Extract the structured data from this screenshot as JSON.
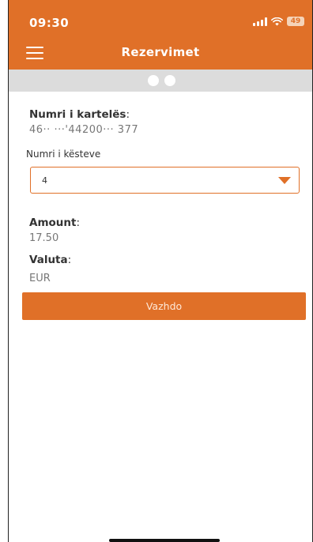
{
  "status_bar": {
    "time": "09:30",
    "battery": "49"
  },
  "nav": {
    "title": "Rezervimet"
  },
  "card": {
    "label": "Numri i kartelës",
    "number": "46·· ···'44200··· 377"
  },
  "installments": {
    "label": "Numri i kësteve",
    "selected": "4"
  },
  "amount": {
    "label": "Amount",
    "value": "17.50"
  },
  "currency": {
    "label": "Valuta",
    "value": "EUR"
  },
  "actions": {
    "continue_label": "Vazhdo"
  },
  "colors": {
    "primary": "#e07028",
    "pager_bg": "#dcdcdc"
  },
  "icons": {
    "menu": "hamburger-icon",
    "dropdown": "caret-down-icon",
    "signal": "signal-icon",
    "wifi": "wifi-icon",
    "battery": "battery-icon"
  }
}
